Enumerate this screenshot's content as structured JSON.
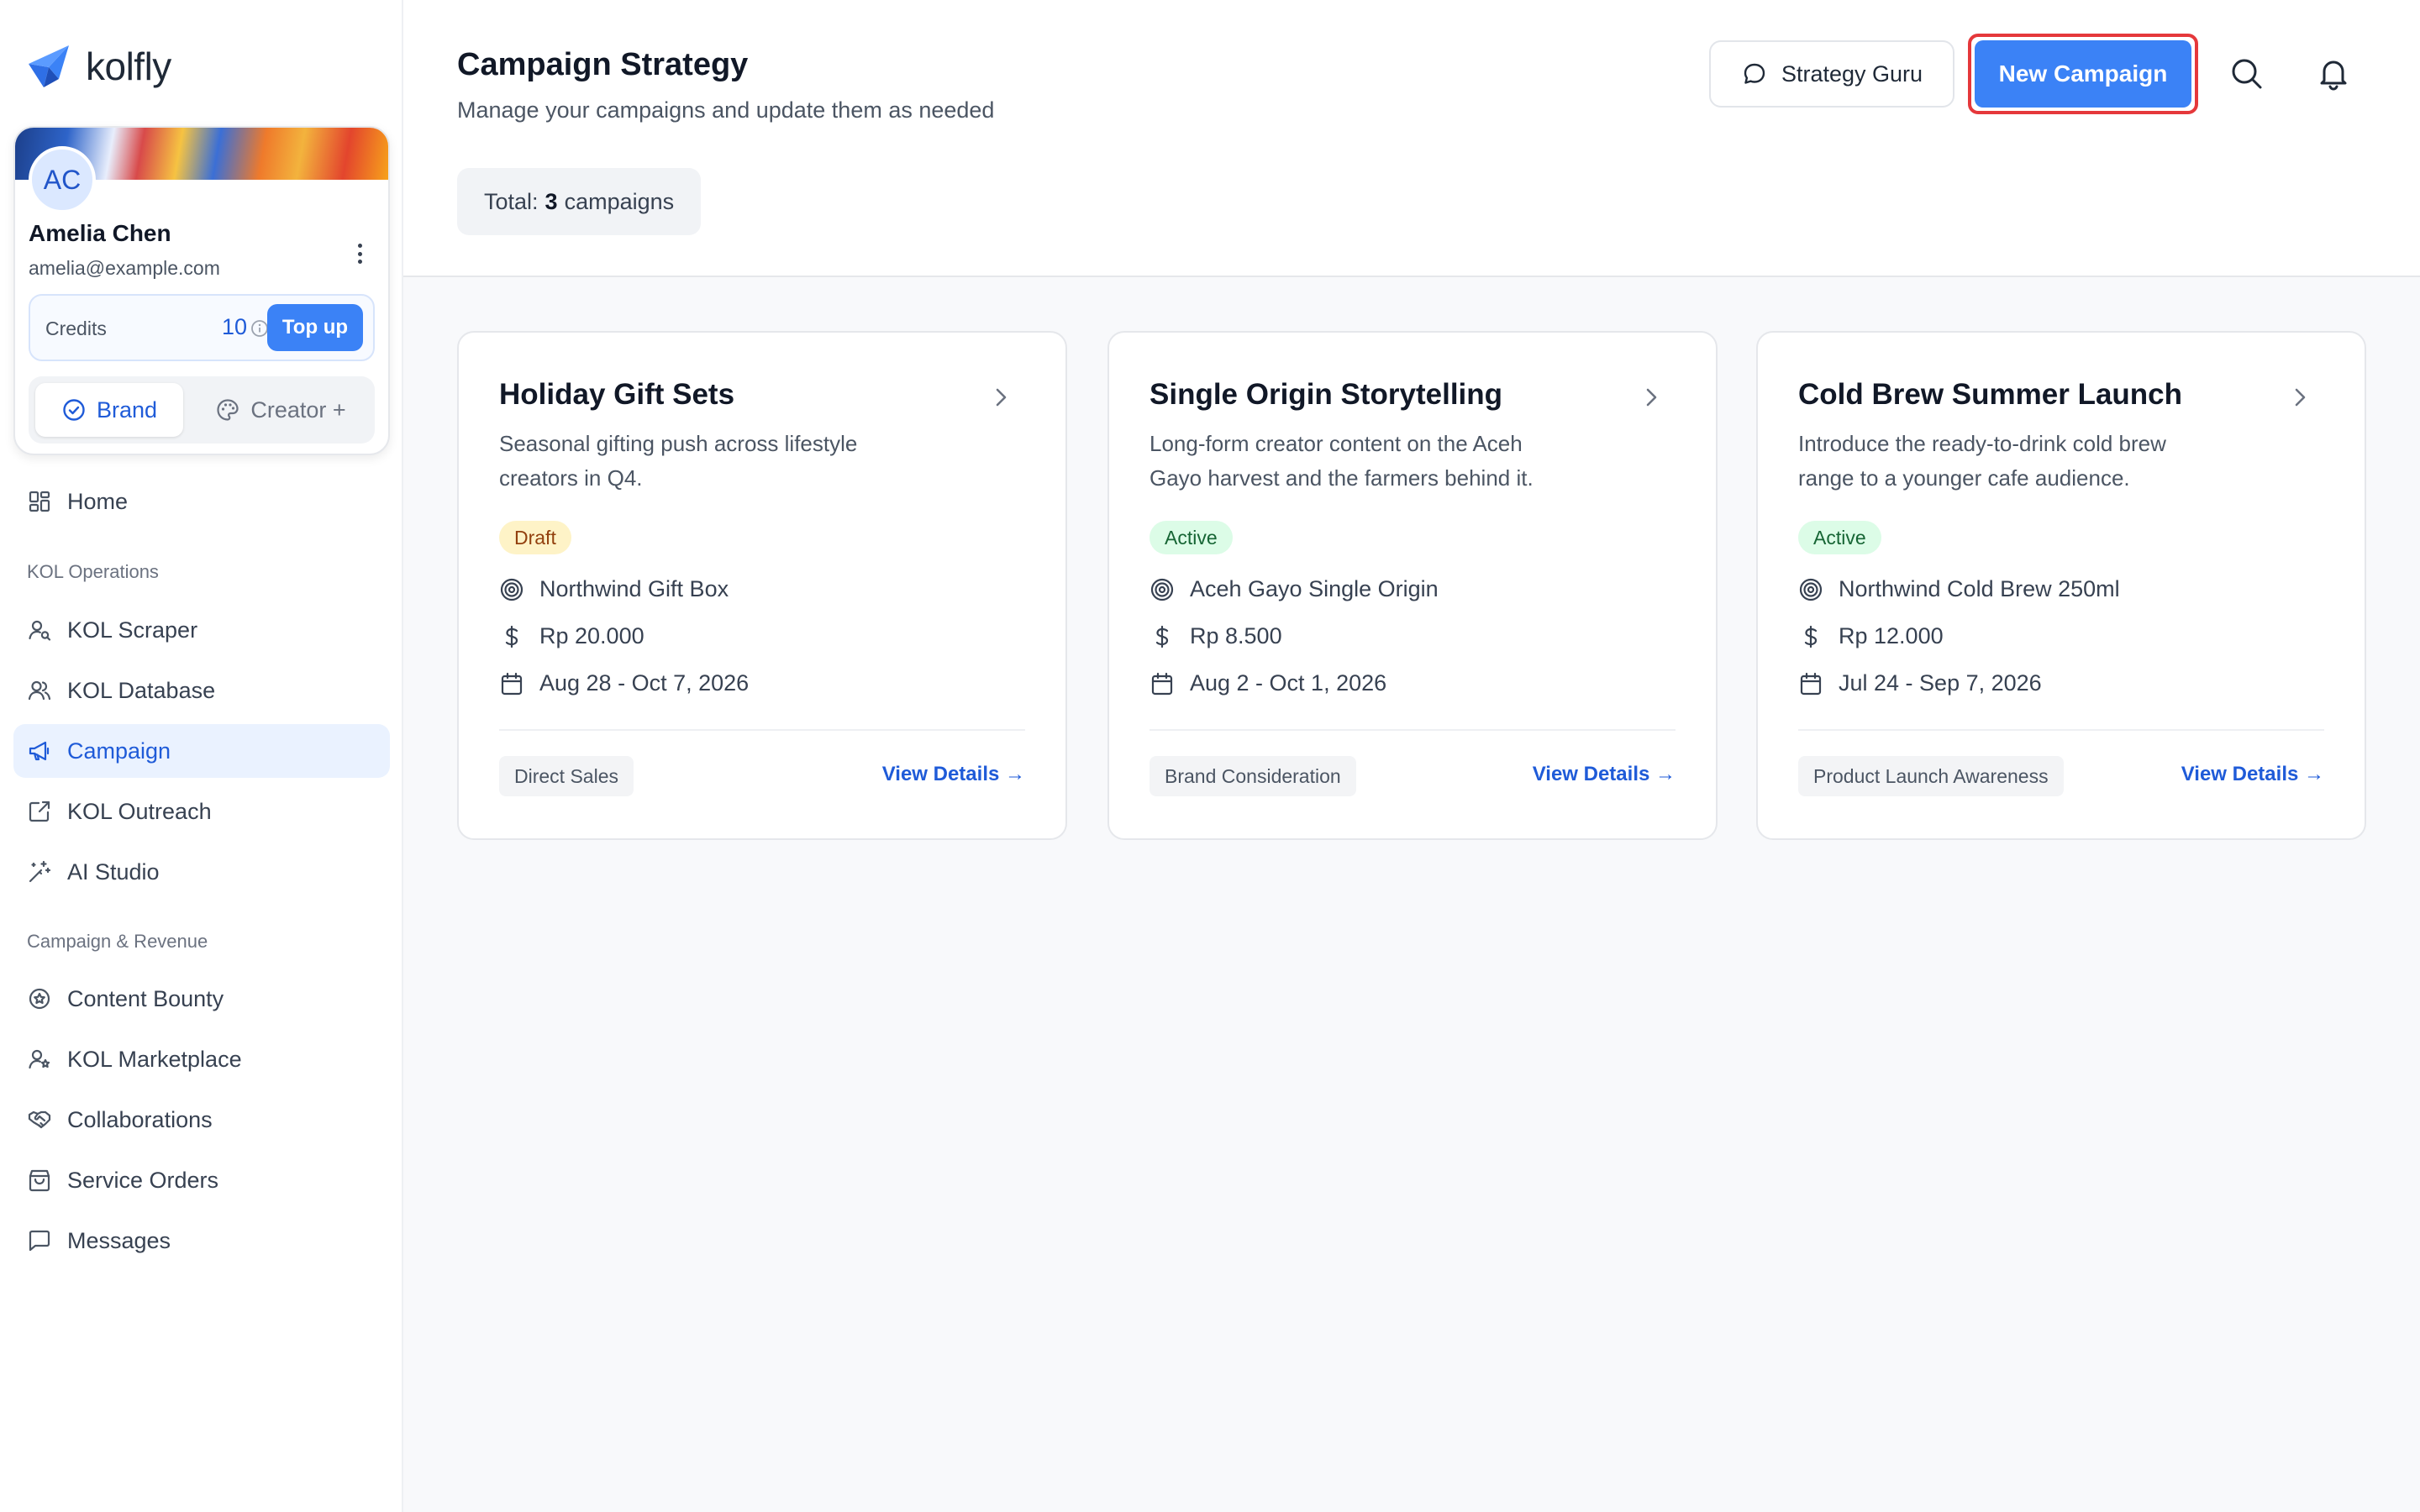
{
  "app": {
    "name": "kolfly"
  },
  "profile": {
    "initials": "AC",
    "name": "Amelia Chen",
    "email": "amelia@example.com",
    "credits_label": "Credits",
    "credits_value": "10",
    "topup_label": "Top up",
    "mode_brand": "Brand",
    "mode_creator": "Creator +"
  },
  "nav": {
    "home": "Home",
    "section_kol": "KOL Operations",
    "kol_scraper": "KOL Scraper",
    "kol_database": "KOL Database",
    "campaign": "Campaign",
    "kol_outreach": "KOL Outreach",
    "ai_studio": "AI Studio",
    "section_revenue": "Campaign & Revenue",
    "content_bounty": "Content Bounty",
    "kol_marketplace": "KOL Marketplace",
    "collaborations": "Collaborations",
    "service_orders": "Service Orders",
    "messages": "Messages"
  },
  "header": {
    "title": "Campaign Strategy",
    "subtitle": "Manage your campaigns and update them as needed",
    "total_prefix": "Total:",
    "total_count": "3",
    "total_suffix": "campaigns",
    "strategy_guru": "Strategy Guru",
    "new_campaign": "New Campaign"
  },
  "campaigns": [
    {
      "title": "Holiday Gift Sets",
      "description": "Seasonal gifting push across lifestyle creators in Q4.",
      "status": "Draft",
      "product": "Northwind Gift Box",
      "budget": "Rp 20.000",
      "dates": "Aug 28 - Oct 7, 2026",
      "objective": "Direct Sales",
      "link": "View Details →"
    },
    {
      "title": "Single Origin Storytelling",
      "description": "Long-form creator content on the Aceh Gayo harvest and the farmers behind it.",
      "status": "Active",
      "product": "Aceh Gayo Single Origin",
      "budget": "Rp 8.500",
      "dates": "Aug 2 - Oct 1, 2026",
      "objective": "Brand Consideration",
      "link": "View Details →"
    },
    {
      "title": "Cold Brew Summer Launch",
      "description": "Introduce the ready-to-drink cold brew range to a younger cafe audience.",
      "status": "Active",
      "product": "Northwind Cold Brew 250ml",
      "budget": "Rp 12.000",
      "dates": "Jul 24 - Sep 7, 2026",
      "objective": "Product Launch Awareness",
      "link": "View Details →"
    }
  ],
  "colors": {
    "accent": "#3b82f6",
    "link": "#1f5bd8",
    "highlight_outline": "#e5383b"
  }
}
